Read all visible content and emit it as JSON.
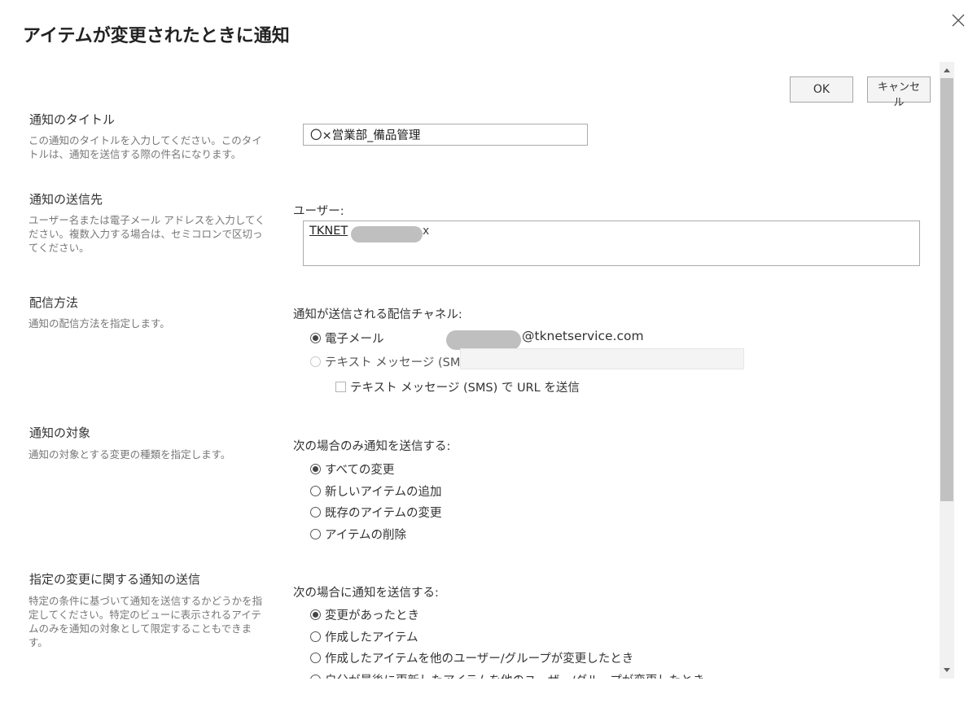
{
  "dialog": {
    "title": "アイテムが変更されたときに通知",
    "close_label": "×"
  },
  "buttons": {
    "ok": "OK",
    "cancel": "キャンセル"
  },
  "sections": {
    "title": {
      "heading": "通知のタイトル",
      "description": "この通知のタイトルを入力してください。このタイトルは、通知を送信する際の件名になります。",
      "value": "〇×営業部_備品管理"
    },
    "recipients": {
      "heading": "通知の送信先",
      "description": "ユーザー名または電子メール アドレスを入力してください。複数入力する場合は、セミコロンで区切ってください。",
      "field_label": "ユーザー:",
      "user_prefix": "TKNET",
      "remove_label": "x"
    },
    "delivery": {
      "heading": "配信方法",
      "description": "通知の配信方法を指定します。",
      "field_label": "通知が送信される配信チャネル:",
      "email_label": "電子メール",
      "email_domain": "@tknetservice.com",
      "sms_label": "テキスト メッセージ (SMS)",
      "sms_url_label": "テキスト メッセージ (SMS) で URL を送信"
    },
    "change_type": {
      "heading": "通知の対象",
      "description": "通知の対象とする変更の種類を指定します。",
      "field_label": "次の場合のみ通知を送信する:",
      "options": [
        "すべての変更",
        "新しいアイテムの追加",
        "既存のアイテムの変更",
        "アイテムの削除"
      ],
      "selected_index": 0
    },
    "criteria": {
      "heading": "指定の変更に関する通知の送信",
      "description": "特定の条件に基づいて通知を送信するかどうかを指定してください。特定のビューに表示されるアイテムのみを通知の対象として限定することもできます。",
      "field_label": "次の場合に通知を送信する:",
      "options": [
        "変更があったとき",
        "作成したアイテム",
        "作成したアイテムを他のユーザー/グループが変更したとき",
        "自分が最後に更新したアイテムを他のユーザー/グループが変更したとき"
      ],
      "selected_index": 0
    }
  }
}
